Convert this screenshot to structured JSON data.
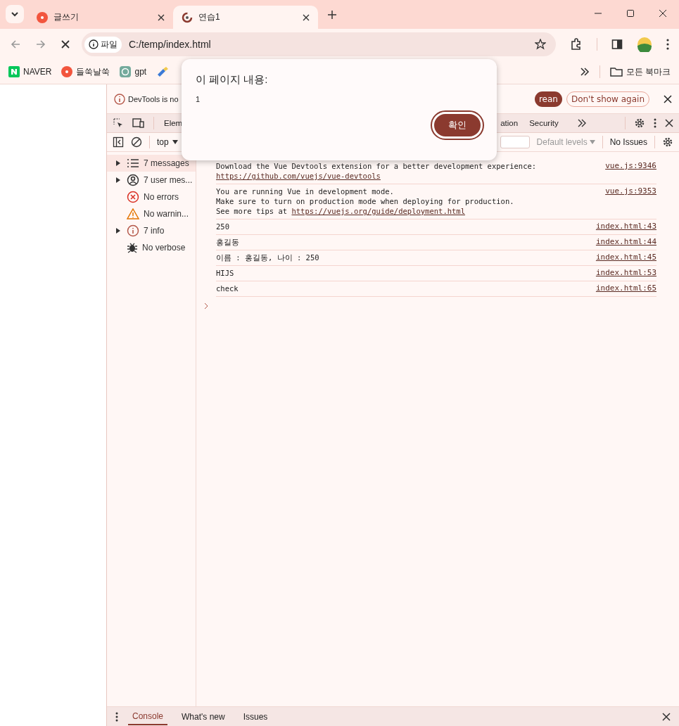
{
  "tabs": [
    {
      "title": "글쓰기",
      "kind": "site",
      "selected": false
    },
    {
      "title": "연습1",
      "kind": "loading",
      "selected": true
    }
  ],
  "address": {
    "scheme": "파일",
    "url": "C:/temp/index.html"
  },
  "bookmarks": [
    {
      "label": "NAVER",
      "kind": "naver"
    },
    {
      "label": "들쑥날쑥",
      "kind": "site"
    },
    {
      "label": "gpt",
      "kind": "gpt"
    }
  ],
  "all_bookmarks": "모든 북마크",
  "devtools": {
    "infobar": {
      "text": "DevTools is no",
      "primary": "rean",
      "secondary": "Don't show again"
    },
    "panel_tabs": [
      {
        "label": "Elem",
        "selected": false
      },
      {
        "label": "ation",
        "selected": false
      },
      {
        "label": "Security",
        "selected": false
      }
    ],
    "context": "top",
    "levels": "Default levels",
    "issues": "No Issues",
    "sidebar": [
      {
        "label": "7 messages",
        "kind": "list",
        "expanded": false,
        "selected": true
      },
      {
        "label": "7 user mes...",
        "kind": "user",
        "expanded": false,
        "selected": false
      },
      {
        "label": "No errors",
        "kind": "error",
        "selected": false
      },
      {
        "label": "No warnin...",
        "kind": "warning",
        "selected": false
      },
      {
        "label": "7 info",
        "kind": "info",
        "expanded": false,
        "selected": false
      },
      {
        "label": "No verbose",
        "kind": "verbose",
        "selected": false
      }
    ],
    "logs": [
      {
        "source": "vue.js:9346",
        "lines": [
          {
            "text": "Download the Vue Devtools extension for a better development experience:"
          },
          {
            "link": "https://github.com/vuejs/vue-devtools"
          }
        ]
      },
      {
        "source": "vue.js:9353",
        "lines": [
          {
            "text": "You are running Vue in development mode."
          },
          {
            "text": "Make sure to turn on production mode when deploying for production."
          },
          {
            "text": "See more tips at ",
            "link": "https://vuejs.org/guide/deployment.html"
          }
        ]
      },
      {
        "source": "index.html:43",
        "lines": [
          {
            "text": "250"
          }
        ]
      },
      {
        "source": "index.html:44",
        "lines": [
          {
            "text": "홍길동"
          }
        ]
      },
      {
        "source": "index.html:45",
        "lines": [
          {
            "text": "이름 : 홍길동, 나이 : 250"
          }
        ]
      },
      {
        "source": "index.html:53",
        "lines": [
          {
            "text": "HIJS"
          }
        ]
      },
      {
        "source": "index.html:65",
        "lines": [
          {
            "text": "check"
          }
        ]
      }
    ],
    "drawer_tabs": [
      {
        "label": "Console",
        "selected": true
      },
      {
        "label": "What's new",
        "selected": false
      },
      {
        "label": "Issues",
        "selected": false
      }
    ]
  },
  "dialog": {
    "title": "이 페이지 내용:",
    "message": "1",
    "button": "확인"
  }
}
